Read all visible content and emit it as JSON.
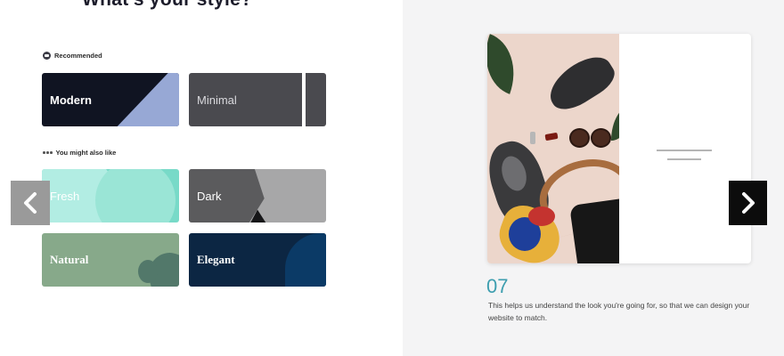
{
  "page": {
    "heading": "What's your style?"
  },
  "recommended": {
    "label": "Recommended",
    "icon": "badge-icon",
    "tiles": [
      {
        "label": "Modern",
        "color": "#101422",
        "accent": "#97a8d5"
      },
      {
        "label": "Minimal",
        "color": "#4a4a4f"
      }
    ]
  },
  "also_like": {
    "label": "You might also like",
    "icon": "more-dots-icon",
    "tiles": [
      {
        "label": "Fresh",
        "color": "#78dac8"
      },
      {
        "label": "Dark",
        "color": "#a7a7a8"
      },
      {
        "label": "Natural",
        "color": "#87a98a"
      },
      {
        "label": "Elegant",
        "color": "#0c2643"
      }
    ]
  },
  "nav": {
    "prev_icon": "chevron-left-icon",
    "next_icon": "chevron-right-icon"
  },
  "preview": {
    "step": "07",
    "description": "This helps us understand the look you're going for, so that we can design your website to match.",
    "step_color": "#3e9eaf"
  }
}
